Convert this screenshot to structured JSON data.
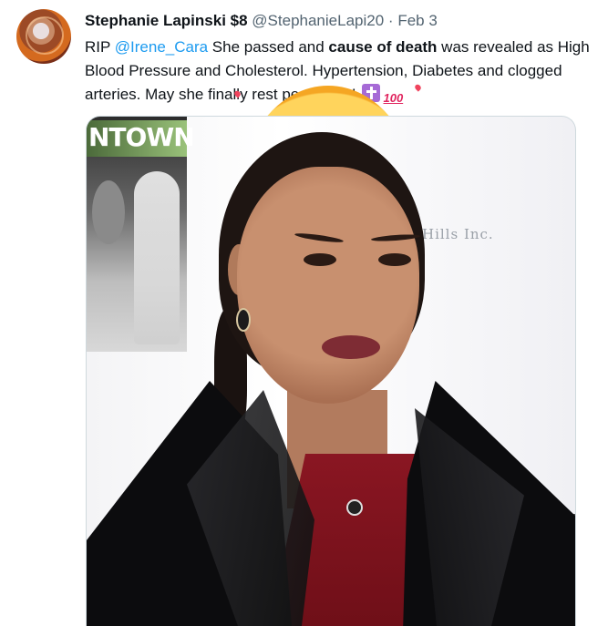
{
  "tweet": {
    "author_name": "Stephanie Lapinski $8",
    "author_handle": "@StephanieLapi20",
    "separator": "·",
    "date": "Feb 3",
    "text": {
      "line1_prefix": "RIP ",
      "mention": "@Irene_Cara",
      "line1_mid": " She passed and ",
      "line1_bold": "cause of death",
      "line1_suffix": " was revealed as High",
      "line2": "Blood Pressure and Cholesterol. Hypertension, Diabetes and clogged",
      "line3": "arteries. May she finally rest peacefully! ",
      "emojis": [
        "latin-cross-emoji",
        "hundred-points-emoji",
        "smiling-face-with-hearts-emoji"
      ]
    },
    "hundred_emoji_text": "100",
    "media": {
      "poster_text": "NTOWN",
      "sponsor_text": "Hills Inc."
    }
  },
  "colors": {
    "mention": "#1d9bf0",
    "text": "#0f1419",
    "secondary": "#536471"
  }
}
